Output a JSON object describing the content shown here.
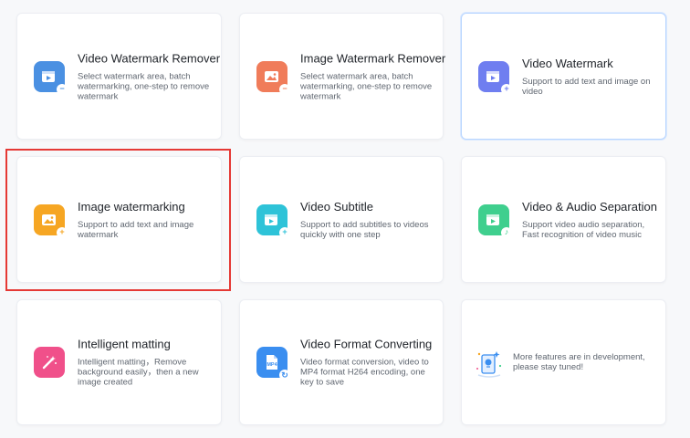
{
  "cards": [
    {
      "title": "Video Watermark Remover",
      "desc": "Select watermark area, batch watermarking, one-step to remove watermark",
      "icon": "video-remove-icon",
      "color": "#4a90e2"
    },
    {
      "title": "Image Watermark Remover",
      "desc": "Select watermark area, batch watermarking, one-step to remove watermark",
      "icon": "image-remove-icon",
      "color": "#f07c5a"
    },
    {
      "title": "Video Watermark",
      "desc": "Support to add text and image on video",
      "icon": "video-watermark-icon",
      "color": "#6f7ef0"
    },
    {
      "title": "Image watermarking",
      "desc": "Support to add text and image watermark",
      "icon": "image-watermark-icon",
      "color": "#f6a623"
    },
    {
      "title": "Video Subtitle",
      "desc": "Support to add subtitles to videos quickly with one step",
      "icon": "video-subtitle-icon",
      "color": "#2ec3d8"
    },
    {
      "title": "Video & Audio Separation",
      "desc": "Support video audio separation, Fast recognition of video music",
      "icon": "audio-separation-icon",
      "color": "#3fcf8e"
    },
    {
      "title": "Intelligent matting",
      "desc": "Intelligent matting，Remove background easily，then a new image created",
      "icon": "magic-wand-icon",
      "color": "#f0508a"
    },
    {
      "title": "Video Format Converting",
      "desc": "Video format conversion, video to MP4 format H264 encoding, one key to save",
      "icon": "mp4-format-icon",
      "color": "#3a8ef0",
      "icon_label": "MP4"
    }
  ],
  "development": {
    "text": "More features are in development, please stay tuned!",
    "icon": "development-icon"
  }
}
